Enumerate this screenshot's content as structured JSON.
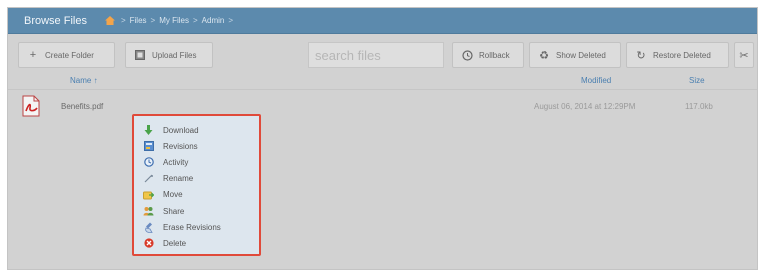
{
  "titlebar": {
    "title": "Browse Files",
    "breadcrumbs": [
      "Files",
      "My Files",
      "Admin"
    ]
  },
  "toolbar": {
    "create_folder": "Create Folder",
    "upload_files": "Upload Files",
    "search_placeholder": "search files",
    "rollback": "Rollback",
    "show_deleted": "Show Deleted",
    "restore_deleted": "Restore Deleted"
  },
  "columns": {
    "name": "Name ↑",
    "modified": "Modified",
    "size": "Size"
  },
  "file": {
    "name": "Benefits.pdf",
    "modified": "August 06, 2014 at 12:29PM",
    "size": "117.0kb"
  },
  "context_menu": {
    "items": [
      {
        "label": "Download",
        "icon": "download-icon"
      },
      {
        "label": "Revisions",
        "icon": "revisions-icon"
      },
      {
        "label": "Activity",
        "icon": "activity-icon"
      },
      {
        "label": "Rename",
        "icon": "rename-icon"
      },
      {
        "label": "Move",
        "icon": "move-icon"
      },
      {
        "label": "Share",
        "icon": "share-icon"
      },
      {
        "label": "Erase Revisions",
        "icon": "erase-revisions-icon"
      },
      {
        "label": "Delete",
        "icon": "delete-icon"
      }
    ]
  },
  "colors": {
    "titlebar": "#5c8aad",
    "menu_border": "#e04a3a",
    "menu_bg": "#dde6ee",
    "link": "#4a7fb0"
  }
}
